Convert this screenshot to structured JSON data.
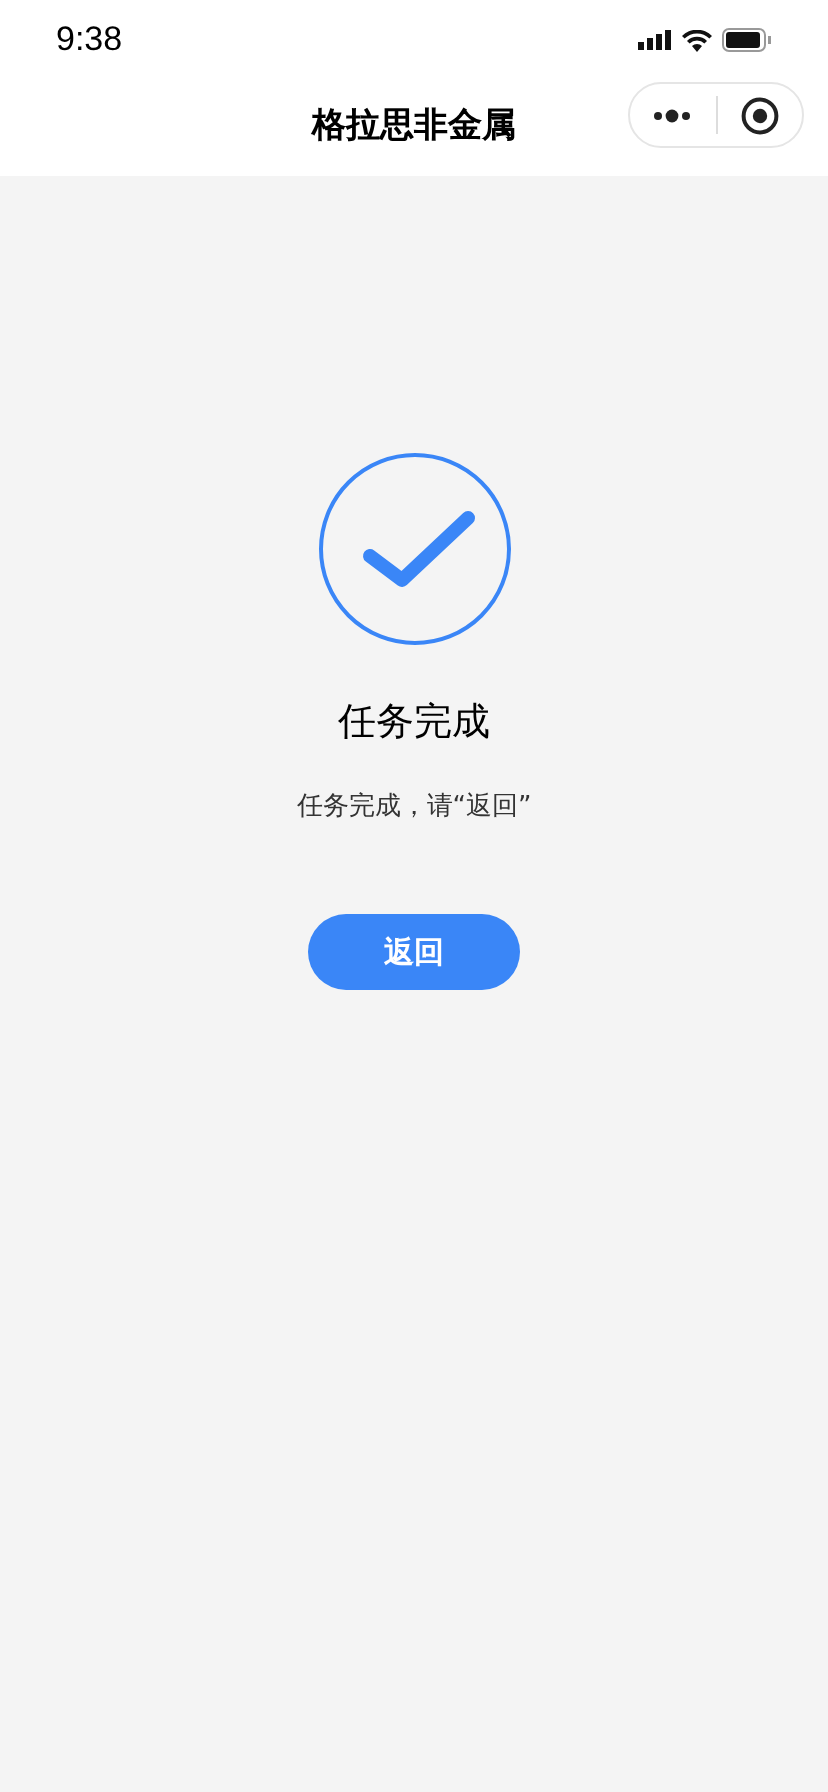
{
  "status_bar": {
    "time": "9:38"
  },
  "nav_bar": {
    "title": "格拉思非金属"
  },
  "result": {
    "title": "任务完成",
    "message": "任务完成，请“返回”",
    "button": "返回"
  }
}
